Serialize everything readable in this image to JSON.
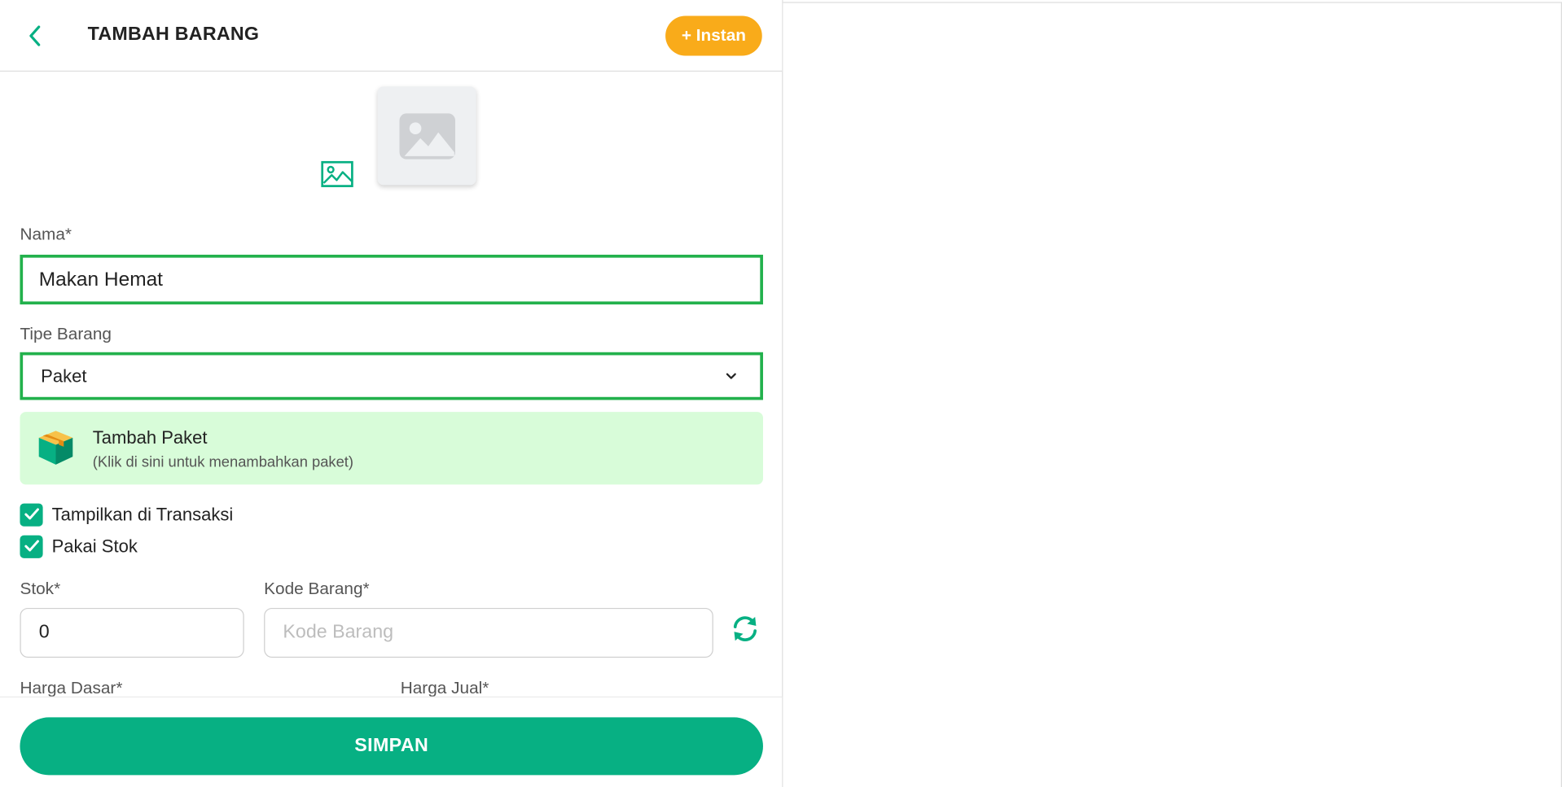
{
  "header": {
    "title": "TAMBAH BARANG",
    "instan_label": "+ Instan"
  },
  "form": {
    "nama_label": "Nama*",
    "nama_value": "Makan Hemat",
    "tipe_label": "Tipe Barang",
    "tipe_value": "Paket",
    "paket_title": "Tambah Paket",
    "paket_subtitle": "(Klik di sini untuk menambahkan paket)",
    "tampilkan_label": "Tampilkan di Transaksi",
    "pakai_stok_label": "Pakai Stok",
    "stok_label": "Stok*",
    "stok_value": "0",
    "kode_label": "Kode Barang*",
    "kode_placeholder": "Kode Barang",
    "harga_dasar_label": "Harga Dasar*",
    "harga_jual_label": "Harga Jual*"
  },
  "footer": {
    "simpan_label": "SIMPAN"
  },
  "icons": {
    "back": "chevron-left-icon",
    "image_upload": "image-icon",
    "image_placeholder": "image-placeholder-icon",
    "chevron": "chevron-down-icon",
    "paket": "box-icon",
    "check": "check-icon",
    "refresh": "refresh-icon"
  },
  "colors": {
    "primary": "#07b083",
    "accent": "#f9ab1a",
    "input_border_active": "#22b14c",
    "paket_bg": "#d8fcd9"
  }
}
